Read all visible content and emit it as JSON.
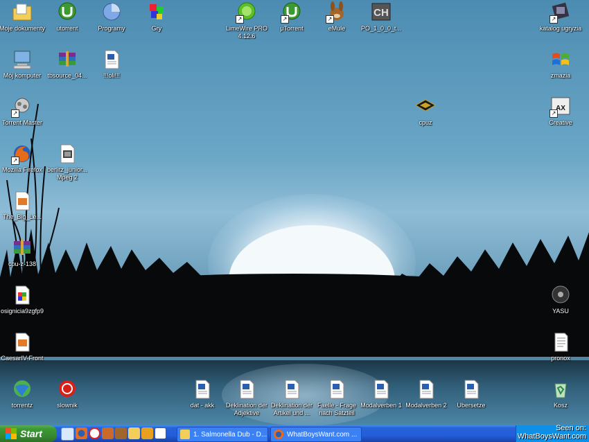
{
  "desktop_icons": {
    "moje_dokumenty": "Moje dokumenty",
    "utorrent": "utorrent",
    "programy": "Programy",
    "gry": "Gry",
    "limewire": "LimeWire PRO 4.12.6",
    "mu_torrent": "µTorrent",
    "emule": "eMule",
    "po_file": "PO_1_0_0_t...",
    "katalog": "katalog ugryzia",
    "moj_komputer": "Mój komputer",
    "tbsource": "tbsource_04...",
    "oli": "!!!oli!!!",
    "zmazia": "zmazia",
    "torrent_master": "Torrent Master",
    "cpuz": "cpuz",
    "creative": "Creative",
    "firefox": "Mozilla Firefox",
    "berlitz": "berlitz_junior... Mpeg 2",
    "big_le": "The_Big_Le...",
    "cpu_z_138": "cpu-z-138",
    "osignicia": "osignicia9zgfp9",
    "yasu": "YASU",
    "caesar": "CaesarIV-Front",
    "pronox": "pronox",
    "torrentz": "torrentz",
    "slownik": "slownik",
    "dat_akk": "dat - akk",
    "deklination_adj": "Deklination der Adjektive",
    "deklination_art": "Deklination der Artikel und ...",
    "faelle": "Faelle - Frage nach Satzteil",
    "modalverben1": "Modalverben 1",
    "modalverben2": "Modalverben 2",
    "ubersetze": "Ubersetze",
    "kosz": "Kosz"
  },
  "taskbar": {
    "start_label": "Start",
    "tasks": [
      "1. Salmonella Dub - D...",
      "WhatBoysWant.com ..."
    ]
  },
  "watermark": {
    "line1": "Seen on:",
    "line2": "WhatBoysWant.com"
  }
}
